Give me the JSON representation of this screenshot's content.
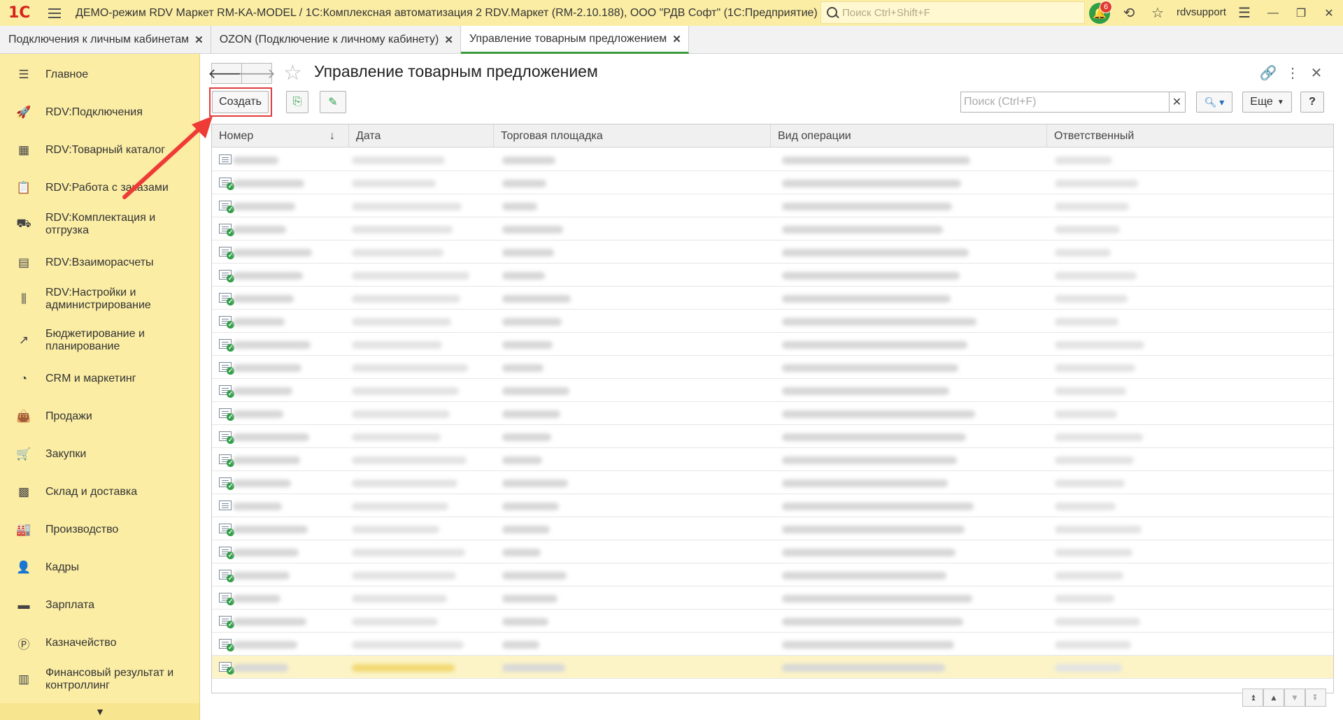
{
  "app": {
    "logo": "1С",
    "title": "ДЕМО-режим RDV Маркет RM-KA-MODEL / 1С:Комплексная автоматизация 2 RDV.Маркет (RM-2.10.188), ООО \"РДВ Софт\"  (1С:Предприятие)",
    "search_placeholder": "Поиск Ctrl+Shift+F",
    "notifications_count": "6",
    "username": "rdvsupport"
  },
  "tabs": [
    {
      "label": "Подключения к личным кабинетам"
    },
    {
      "label": "OZON (Подключение к личному кабинету)"
    },
    {
      "label": "Управление товарным предложением",
      "active": true
    }
  ],
  "sidebar": {
    "items": [
      {
        "label": "Главное",
        "icon": "menu-lines-icon"
      },
      {
        "label": "RDV:Подключения",
        "icon": "rocket-icon"
      },
      {
        "label": "RDV:Товарный каталог",
        "icon": "grid-icon"
      },
      {
        "label": "RDV:Работа с заказами",
        "icon": "clipboard-icon"
      },
      {
        "label": "RDV:Комплектация и отгрузка",
        "icon": "cart-dolly-icon"
      },
      {
        "label": "RDV:Взаиморасчеты",
        "icon": "calculator-icon"
      },
      {
        "label": "RDV:Настройки и администрирование",
        "icon": "sliders-icon"
      },
      {
        "label": "Бюджетирование и планирование",
        "icon": "chart-up-icon"
      },
      {
        "label": "CRM и маркетинг",
        "icon": "pie-icon"
      },
      {
        "label": "Продажи",
        "icon": "bag-icon"
      },
      {
        "label": "Закупки",
        "icon": "basket-icon"
      },
      {
        "label": "Склад и доставка",
        "icon": "boxes-icon"
      },
      {
        "label": "Производство",
        "icon": "factory-icon"
      },
      {
        "label": "Кадры",
        "icon": "person-icon"
      },
      {
        "label": "Зарплата",
        "icon": "wallet-icon"
      },
      {
        "label": "Казначейство",
        "icon": "coin-icon"
      },
      {
        "label": "Финансовый результат и контроллинг",
        "icon": "bar-chart-icon"
      }
    ]
  },
  "form": {
    "title": "Управление товарным предложением",
    "create_label": "Создать",
    "search_placeholder": "Поиск (Ctrl+F)",
    "more_label": "Еще",
    "help_label": "?"
  },
  "table": {
    "columns": [
      "Номер",
      "Дата",
      "Торговая площадка",
      "Вид операции",
      "Ответственный"
    ],
    "sort_indicator": "↓",
    "row_count": 23,
    "row_status": [
      "draft",
      "posted",
      "posted",
      "posted",
      "posted",
      "posted",
      "posted",
      "posted",
      "posted",
      "posted",
      "posted",
      "posted",
      "posted",
      "posted",
      "posted",
      "draft",
      "posted",
      "posted",
      "posted",
      "posted",
      "posted",
      "posted",
      "posted"
    ],
    "selected_row": 23
  },
  "colors": {
    "accent_yellow": "#fbeda4",
    "active_tab_underline": "#3a9a3a",
    "highlight_red": "#e23b3b",
    "selected_row": "#fcf4c7"
  }
}
